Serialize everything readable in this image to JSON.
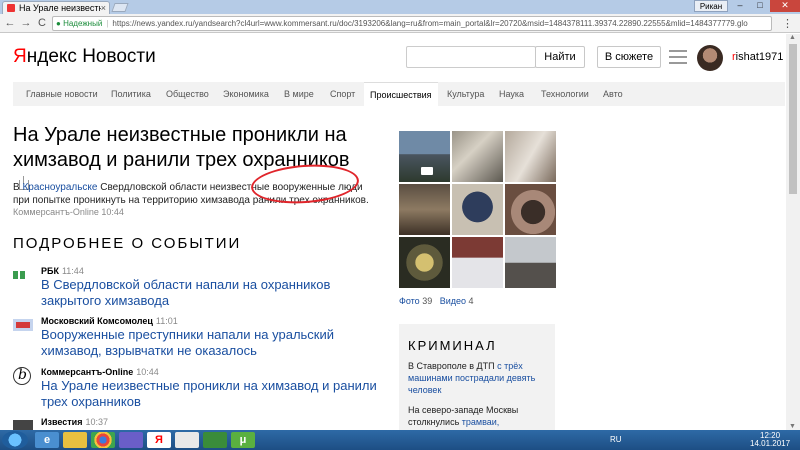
{
  "browser": {
    "tab_title": "На Урале неизвестн",
    "tab_close": "×",
    "window_user": "Рикан",
    "win_min": "–",
    "win_max": "□",
    "win_close": "✕",
    "back": "←",
    "forward": "→",
    "reload": "C",
    "lock": "🔒",
    "secure_label": "Надежный",
    "url": "https://news.yandex.ru/yandsearch?cl4url=www.kommersant.ru/doc/3193206&lang=ru&from=main_portal&lr=20720&msid=1484378111.39374.22890.22555&mlid=1484377779.glo",
    "menu": "⋮"
  },
  "header": {
    "logo_y": "Я",
    "logo_rest": "ндекс",
    "logo_news": "Новости",
    "find_button": "Найти",
    "story_button": "В сюжете",
    "username_first": "r",
    "username_rest": "ishat1971"
  },
  "nav": {
    "items": [
      "Главные новости",
      "Политика",
      "Общество",
      "Экономика",
      "В мире",
      "Спорт",
      "Происшествия",
      "Культура",
      "Наука",
      "Технологии",
      "Авто"
    ],
    "active_index": 6
  },
  "article": {
    "headline": "На Урале неизвестные проникли на химзавод и ранили трех охранников",
    "lead_prefix": "В ",
    "lead_link": "Красноуральске",
    "lead_rest": " Свердловской области неизвестные вооруженные люди при попытке проникнуть на территорию химзавода ранили трех охранников.",
    "source": "Коммерсантъ-Online",
    "time": "10:44"
  },
  "section_title": "ПОДРОБНЕЕ О СОБЫТИИ",
  "news": [
    {
      "source": "РБК",
      "time": "11:44",
      "title": "В Свердловской области напали на охранников закрытого химзавода"
    },
    {
      "source": "Московский Комсомолец",
      "time": "11:01",
      "title": "Вооруженные преступники напали на уральский химзавод, взрывчатки не оказалось"
    },
    {
      "source": "Коммерсантъ-Online",
      "time": "10:44",
      "title": "На Урале неизвестные проникли на химзавод и ранили трех охранников"
    },
    {
      "source": "Известия",
      "time": "10:37",
      "title": ""
    }
  ],
  "media": {
    "photo_label": "Фото",
    "photo_count": "39",
    "video_label": "Видео",
    "video_count": "4"
  },
  "criminal": {
    "heading": "КРИМИНАЛ",
    "item1_prefix": "В Ставрополе в ДТП ",
    "item1_link": "с трёх машинами пострадали девять человек",
    "item2_prefix": "На северо-западе Москвы столкнулись ",
    "item2_link": "трамваи, пострадали"
  },
  "taskbar": {
    "yandex_icon": "Я",
    "torrent_icon": "μ",
    "lang": "RU",
    "time": "12:20",
    "date": "14.01.2017"
  },
  "colors": {
    "link": "#1a4fa0",
    "annotation_ellipse": "#e0252b",
    "logo_red": "#ff0000"
  }
}
